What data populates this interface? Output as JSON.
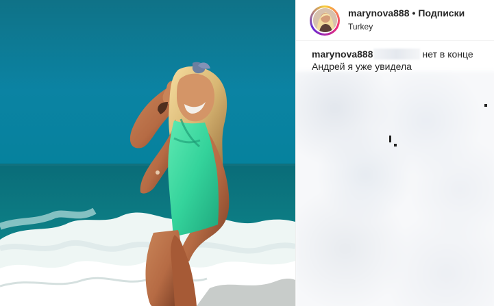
{
  "post": {
    "username": "marynova888",
    "separator": "•",
    "follow_label": "Подписки",
    "location": "Turkey"
  },
  "comment": {
    "author": "marynova888",
    "text_line_1": "нет в конце",
    "text_line_2": "Андрей я уже увидела"
  }
}
